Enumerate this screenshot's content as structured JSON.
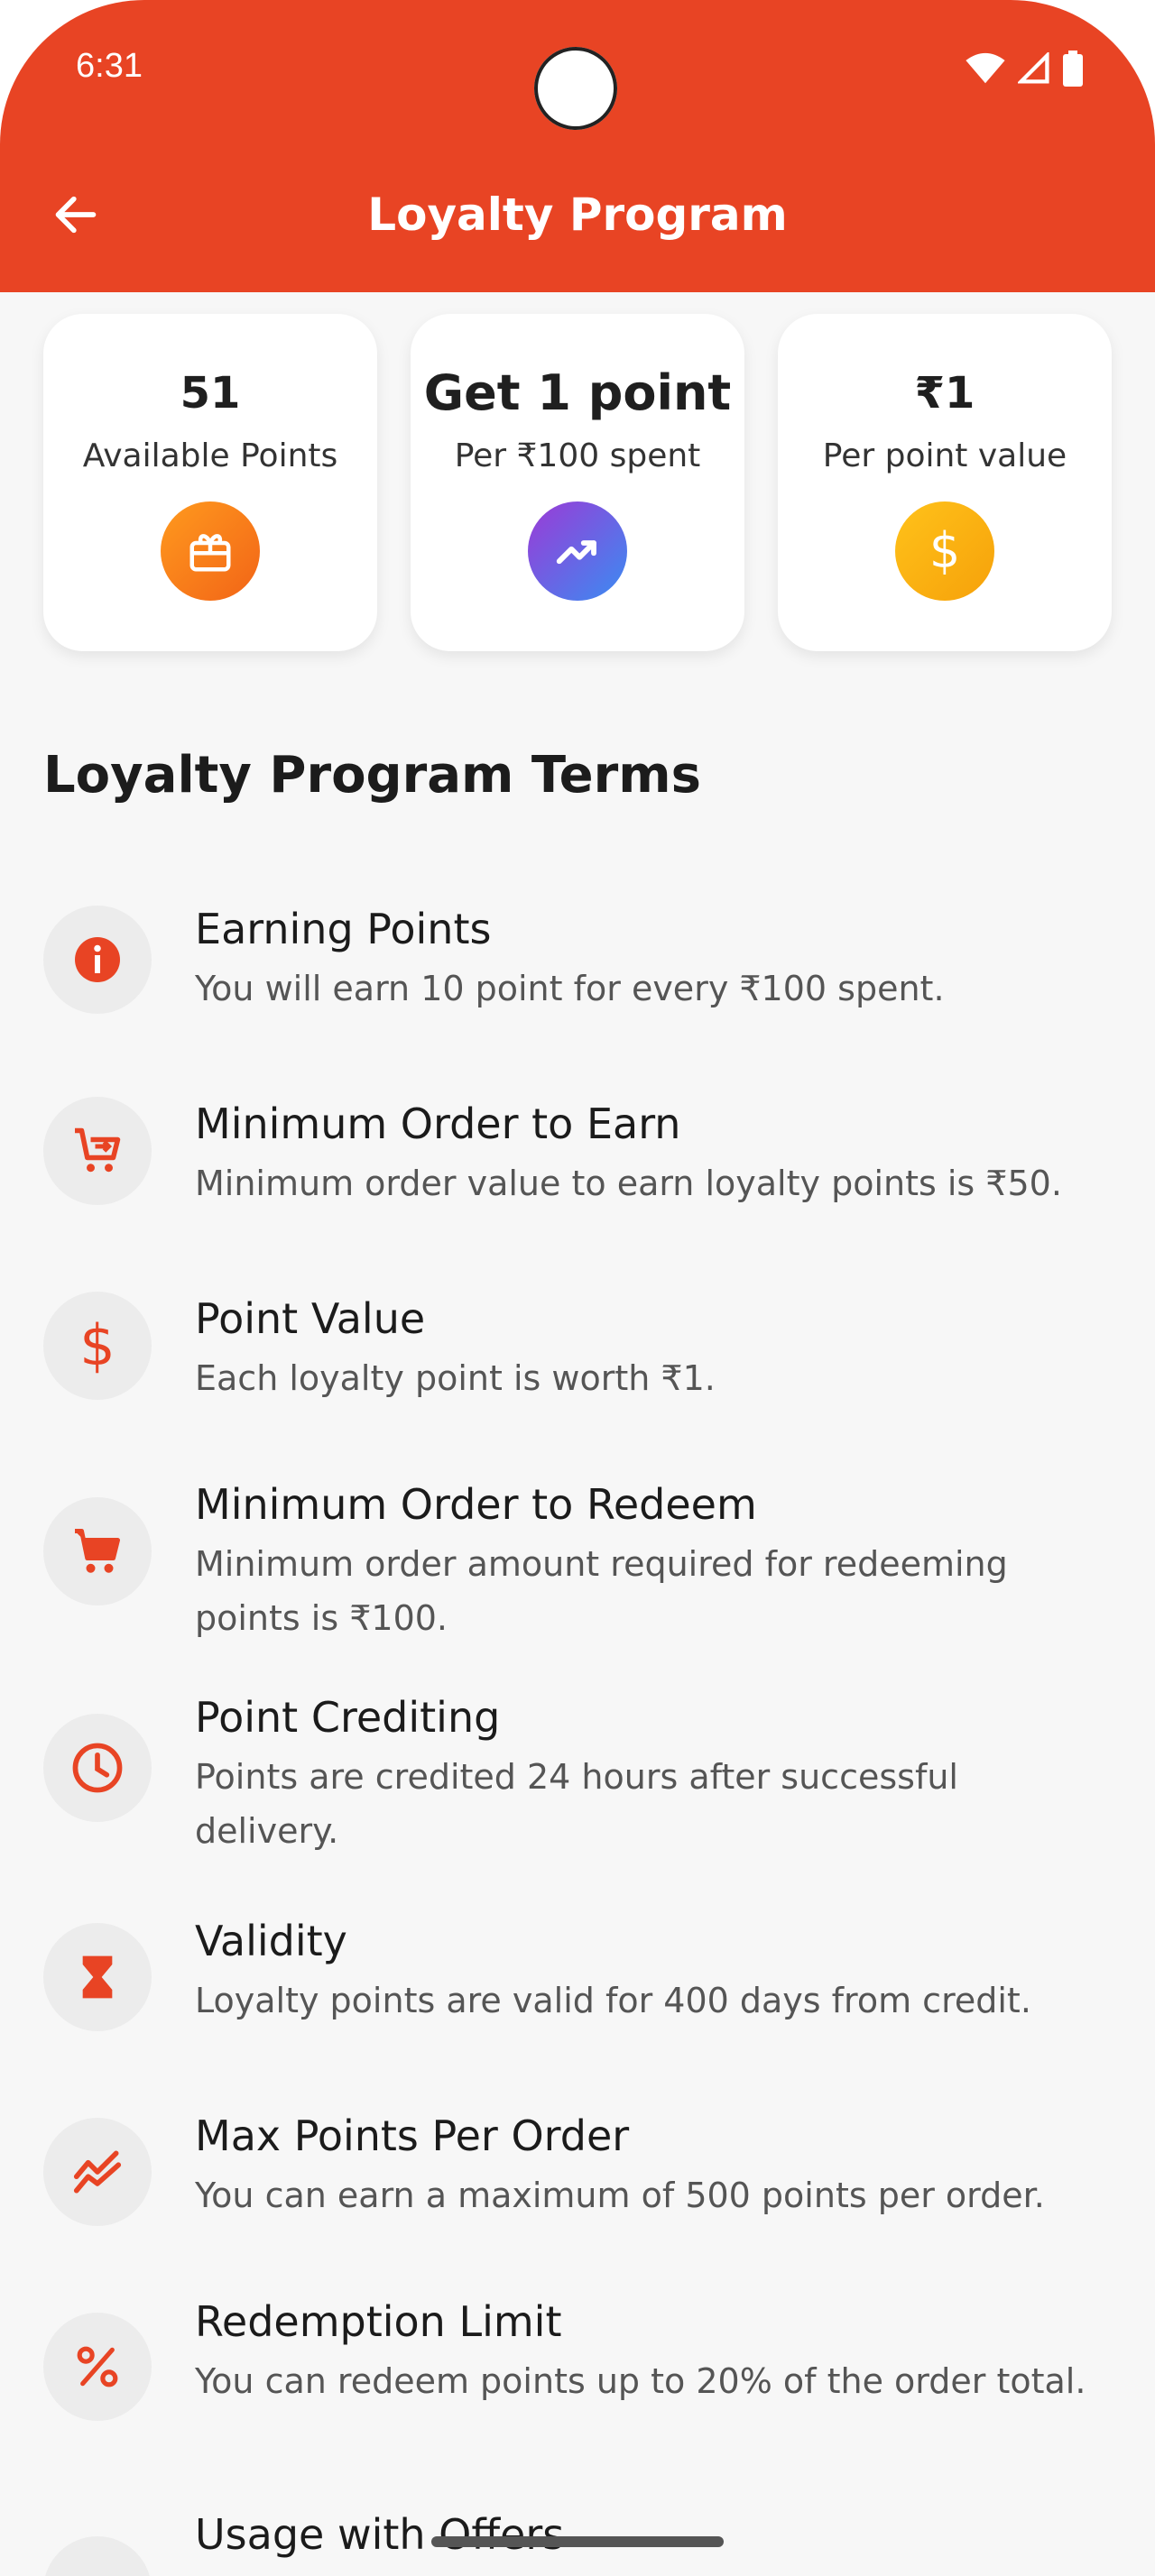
{
  "status_bar": {
    "time": "6:31"
  },
  "header": {
    "title": "Loyalty Program"
  },
  "cards": [
    {
      "value": "51",
      "label": "Available Points",
      "icon": "gift-icon",
      "color": "#f26417"
    },
    {
      "value": "Get 1 point",
      "label": "Per ₹100 spent",
      "icon": "trending-up-icon",
      "color": "#7a4be0"
    },
    {
      "value": "₹1",
      "label": "Per point value",
      "icon": "dollar-icon",
      "color": "#f6a10a"
    }
  ],
  "section": {
    "title": "Loyalty Program Terms"
  },
  "terms": [
    {
      "title": "Earning Points",
      "desc": "You will earn 10 point for every ₹100 spent.",
      "icon": "info-icon"
    },
    {
      "title": "Minimum Order to Earn",
      "desc": "Minimum order value to earn loyalty points is ₹50.",
      "icon": "cart-add-icon"
    },
    {
      "title": "Point Value",
      "desc": "Each loyalty point is worth ₹1.",
      "icon": "dollar-icon"
    },
    {
      "title": "Minimum Order to Redeem",
      "desc": "Minimum order amount required for redeeming points is ₹100.",
      "icon": "cart-icon"
    },
    {
      "title": "Point Crediting",
      "desc": "Points are credited 24 hours after successful delivery.",
      "icon": "clock-icon"
    },
    {
      "title": "Validity",
      "desc": "Loyalty points are valid for 400 days from credit.",
      "icon": "hourglass-icon"
    },
    {
      "title": "Max Points Per Order",
      "desc": "You can earn a maximum of 500 points per order.",
      "icon": "multiline-chart-icon"
    },
    {
      "title": "Redemption Limit",
      "desc": "You can redeem points up to 20% of the order total.",
      "icon": "percent-icon"
    },
    {
      "title": "Usage with Offers",
      "desc": "",
      "icon": "offers-icon"
    }
  ],
  "colors": {
    "primary": "#e84424",
    "background": "#f7f7f7",
    "icon_bg": "#ececec"
  }
}
